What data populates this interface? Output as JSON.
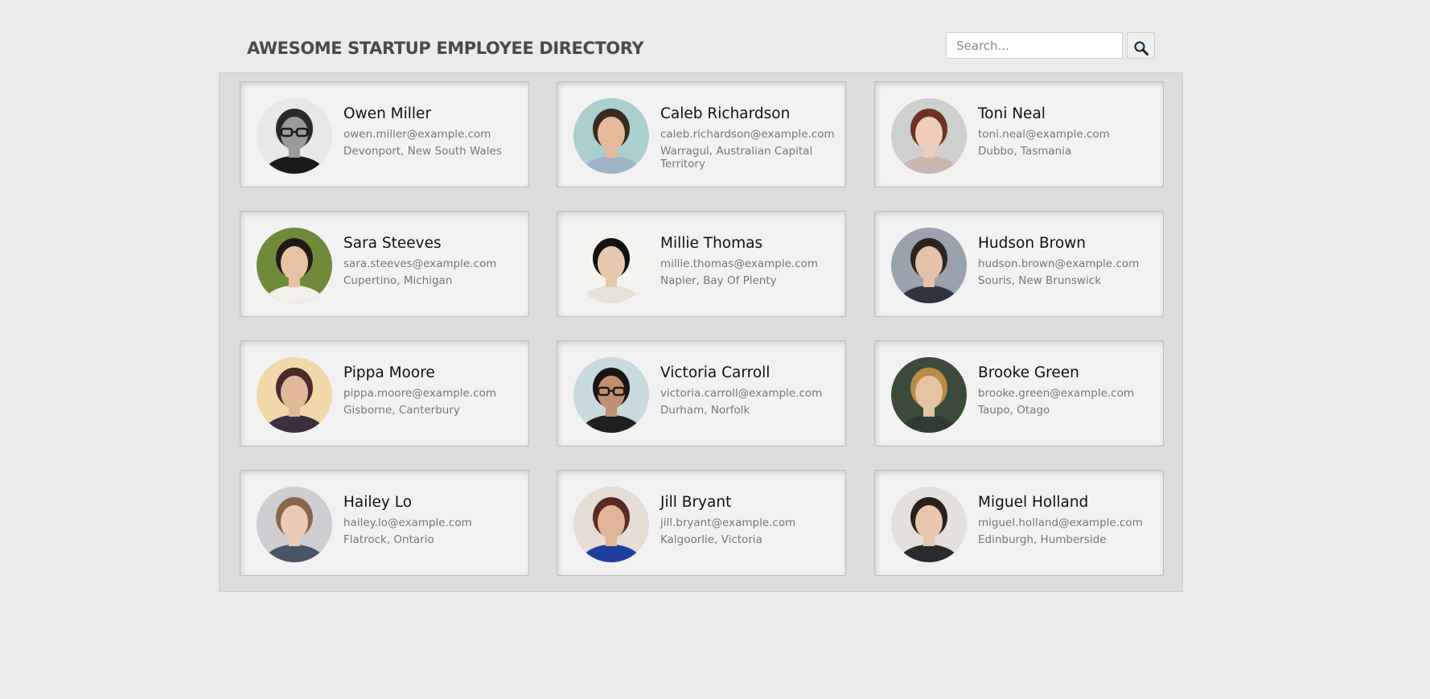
{
  "header": {
    "title": "AWESOME STARTUP EMPLOYEE DIRECTORY",
    "search_placeholder": "Search...",
    "search_icon": "magnifier-icon"
  },
  "colors": {
    "page_background": "#ebebeb",
    "gallery_background": "#dcdcdc",
    "card_background": "#f2f2f2",
    "name_text": "#111111",
    "secondary_text": "#777777",
    "title_text": "#4a4a4a"
  },
  "employees": [
    {
      "name": "Owen Miller",
      "email": "owen.miller@example.com",
      "location": "Devonport, New South Wales",
      "avatar": {
        "bg": "#e8e8e8",
        "skin": "#9a9a9a",
        "hair": "#2a2a2a",
        "shirt": "#1a1a1a",
        "glasses": true
      }
    },
    {
      "name": "Caleb Richardson",
      "email": "caleb.richardson@example.com",
      "location": "Warragul, Australian Capital Territory",
      "avatar": {
        "bg": "#a9cfcf",
        "skin": "#e6b99a",
        "hair": "#3b2a20",
        "shirt": "#9fb3c8",
        "glasses": false
      }
    },
    {
      "name": "Toni Neal",
      "email": "toni.neal@example.com",
      "location": "Dubbo, Tasmania",
      "avatar": {
        "bg": "#cfcfcf",
        "skin": "#efcdb8",
        "hair": "#6e3326",
        "shirt": "#c7b7b0",
        "glasses": false
      }
    },
    {
      "name": "Sara Steeves",
      "email": "sara.steeves@example.com",
      "location": "Cupertino, Michigan",
      "avatar": {
        "bg": "#6f8b3a",
        "skin": "#e9c2a4",
        "hair": "#241a14",
        "shirt": "#f3efea",
        "glasses": false
      }
    },
    {
      "name": "Millie Thomas",
      "email": "millie.thomas@example.com",
      "location": "Napier, Bay Of Plenty",
      "avatar": {
        "bg": "#f4f4ee",
        "skin": "#e8c8ad",
        "hair": "#111111",
        "shirt": "#e8e2d8",
        "glasses": false
      }
    },
    {
      "name": "Hudson Brown",
      "email": "hudson.brown@example.com",
      "location": "Souris, New Brunswick",
      "avatar": {
        "bg": "#9aa3ad",
        "skin": "#e5c1a8",
        "hair": "#2c2420",
        "shirt": "#2e3440",
        "glasses": false
      }
    },
    {
      "name": "Pippa Moore",
      "email": "pippa.moore@example.com",
      "location": "Gisborne, Canterbury",
      "avatar": {
        "bg": "#f2d8a8",
        "skin": "#e2b89a",
        "hair": "#4a2a2a",
        "shirt": "#3a3040",
        "glasses": false
      }
    },
    {
      "name": "Victoria Carroll",
      "email": "victoria.carroll@example.com",
      "location": "Durham, Norfolk",
      "avatar": {
        "bg": "#c9dadf",
        "skin": "#c28f6e",
        "hair": "#1a1414",
        "shirt": "#1f1f1f",
        "glasses": true
      }
    },
    {
      "name": "Brooke Green",
      "email": "brooke.green@example.com",
      "location": "Taupo, Otago",
      "avatar": {
        "bg": "#3c4a3a",
        "skin": "#e6c4a2",
        "hair": "#b98b45",
        "shirt": "#2f3b35",
        "glasses": false
      }
    },
    {
      "name": "Hailey Lo",
      "email": "hailey.lo@example.com",
      "location": "Flatrock, Ontario",
      "avatar": {
        "bg": "#cfcdd2",
        "skin": "#ecc9b3",
        "hair": "#8a6648",
        "shirt": "#4a5468",
        "glasses": false
      }
    },
    {
      "name": "Jill Bryant",
      "email": "jill.bryant@example.com",
      "location": "Kalgoorlie, Victoria",
      "avatar": {
        "bg": "#e6ddd4",
        "skin": "#e0b597",
        "hair": "#5a2a22",
        "shirt": "#1f3fa0",
        "glasses": false
      }
    },
    {
      "name": "Miguel Holland",
      "email": "miguel.holland@example.com",
      "location": "Edinburgh, Humberside",
      "avatar": {
        "bg": "#e3e0de",
        "skin": "#e9c5ad",
        "hair": "#2a201a",
        "shirt": "#2a2a2e",
        "glasses": false
      }
    }
  ]
}
